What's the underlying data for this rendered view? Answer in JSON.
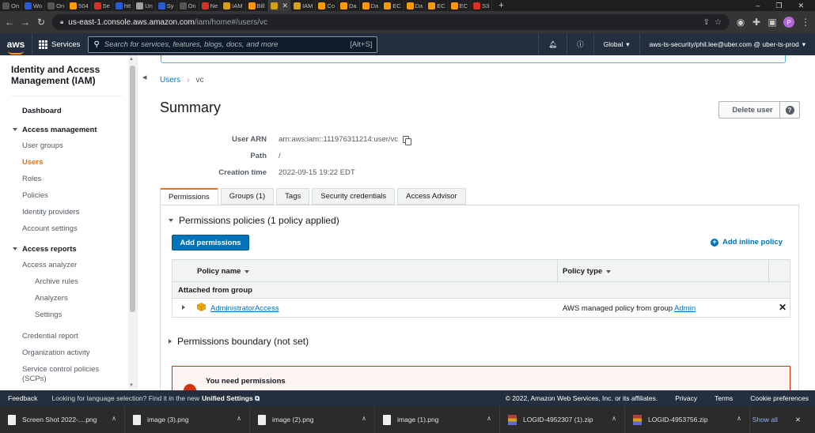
{
  "browser": {
    "tabs": [
      {
        "label": "On",
        "color": "#555555"
      },
      {
        "label": "Wo",
        "color": "#2a5bd7"
      },
      {
        "label": "On",
        "color": "#555555"
      },
      {
        "label": "504",
        "color": "#ff9900"
      },
      {
        "label": "Se",
        "color": "#d93025"
      },
      {
        "label": "htt",
        "color": "#2a5bd7"
      },
      {
        "label": "Un",
        "color": "#9aa0a6"
      },
      {
        "label": "Sy",
        "color": "#2a5bd7"
      },
      {
        "label": "On",
        "color": "#555555"
      },
      {
        "label": "Ne",
        "color": "#d93025"
      },
      {
        "label": "IAM",
        "color": "#d4a017"
      },
      {
        "label": "Bill",
        "color": "#ff9900"
      },
      {
        "label": "",
        "color": "#d4a017",
        "active": true
      },
      {
        "label": "IAM",
        "color": "#d4a017"
      },
      {
        "label": "Co",
        "color": "#ff9900"
      },
      {
        "label": "Da",
        "color": "#ff9900"
      },
      {
        "label": "Da",
        "color": "#ff9900"
      },
      {
        "label": "EC",
        "color": "#ff9900"
      },
      {
        "label": "Da",
        "color": "#ff9900"
      },
      {
        "label": "EC",
        "color": "#ff9900"
      },
      {
        "label": "EC",
        "color": "#ff9900"
      },
      {
        "label": "S3",
        "color": "#d93025"
      }
    ],
    "url_host": "us-east-1.console.aws.amazon.com",
    "url_path": "/iam/home#/users/vc",
    "profile_initial": "P"
  },
  "awsnav": {
    "logo": "aws",
    "services_label": "Services",
    "search_placeholder": "Search for services, features, blogs, docs, and more",
    "search_shortcut": "[Alt+S]",
    "region": "Global",
    "account": "aws-ts-security/phil.lee@uber.com @ uber-ts-prod"
  },
  "sidebar": {
    "title": "Identity and Access Management (IAM)",
    "dashboard": "Dashboard",
    "access_management": "Access management",
    "am_items": [
      "User groups",
      "Users",
      "Roles",
      "Policies",
      "Identity providers",
      "Account settings"
    ],
    "access_reports": "Access reports",
    "ar_items": [
      "Access analyzer"
    ],
    "analyzer_items": [
      "Archive rules",
      "Analyzers",
      "Settings"
    ],
    "more_items": [
      "Credential report",
      "Organization activity",
      "Service control policies (SCPs)"
    ]
  },
  "main": {
    "breadcrumb": {
      "parent": "Users",
      "current": "vc"
    },
    "title": "Summary",
    "delete_label": "Delete user",
    "help_label": "?",
    "fields": [
      {
        "label": "User ARN",
        "value": "arn:aws:iam::111976311214:user/vc"
      },
      {
        "label": "Path",
        "value": "/"
      },
      {
        "label": "Creation time",
        "value": "2022-09-15 19:22 EDT"
      }
    ],
    "tabs": [
      "Permissions",
      "Groups (1)",
      "Tags",
      "Security credentials",
      "Access Advisor"
    ],
    "policies_title": "Permissions policies (1 policy applied)",
    "add_permissions": "Add permissions",
    "add_inline": "Add inline policy",
    "columns": [
      "Policy name",
      "Policy type"
    ],
    "group_header": "Attached from group",
    "policy_name": "AdministratorAccess",
    "policy_type_prefix": "AWS managed policy from group ",
    "policy_group": "Admin",
    "boundary_title": "Permissions boundary (not set)",
    "warning": "You need permissions"
  },
  "footer": {
    "feedback": "Feedback",
    "lang_text": "Looking for language selection? Find it in the new",
    "lang_link": "Unified Settings",
    "copyright": "© 2022, Amazon Web Services, Inc. or its affiliates.",
    "links": [
      "Privacy",
      "Terms",
      "Cookie preferences"
    ]
  },
  "downloads": {
    "items": [
      {
        "name": "Screen Shot 2022-....png",
        "kind": "file"
      },
      {
        "name": "image (3).png",
        "kind": "file"
      },
      {
        "name": "image (2).png",
        "kind": "file"
      },
      {
        "name": "image (1).png",
        "kind": "file"
      },
      {
        "name": "LOGID-4952307 (1).zip",
        "kind": "zip"
      },
      {
        "name": "LOGID-4953756.zip",
        "kind": "zip"
      }
    ],
    "show_all": "Show all"
  }
}
